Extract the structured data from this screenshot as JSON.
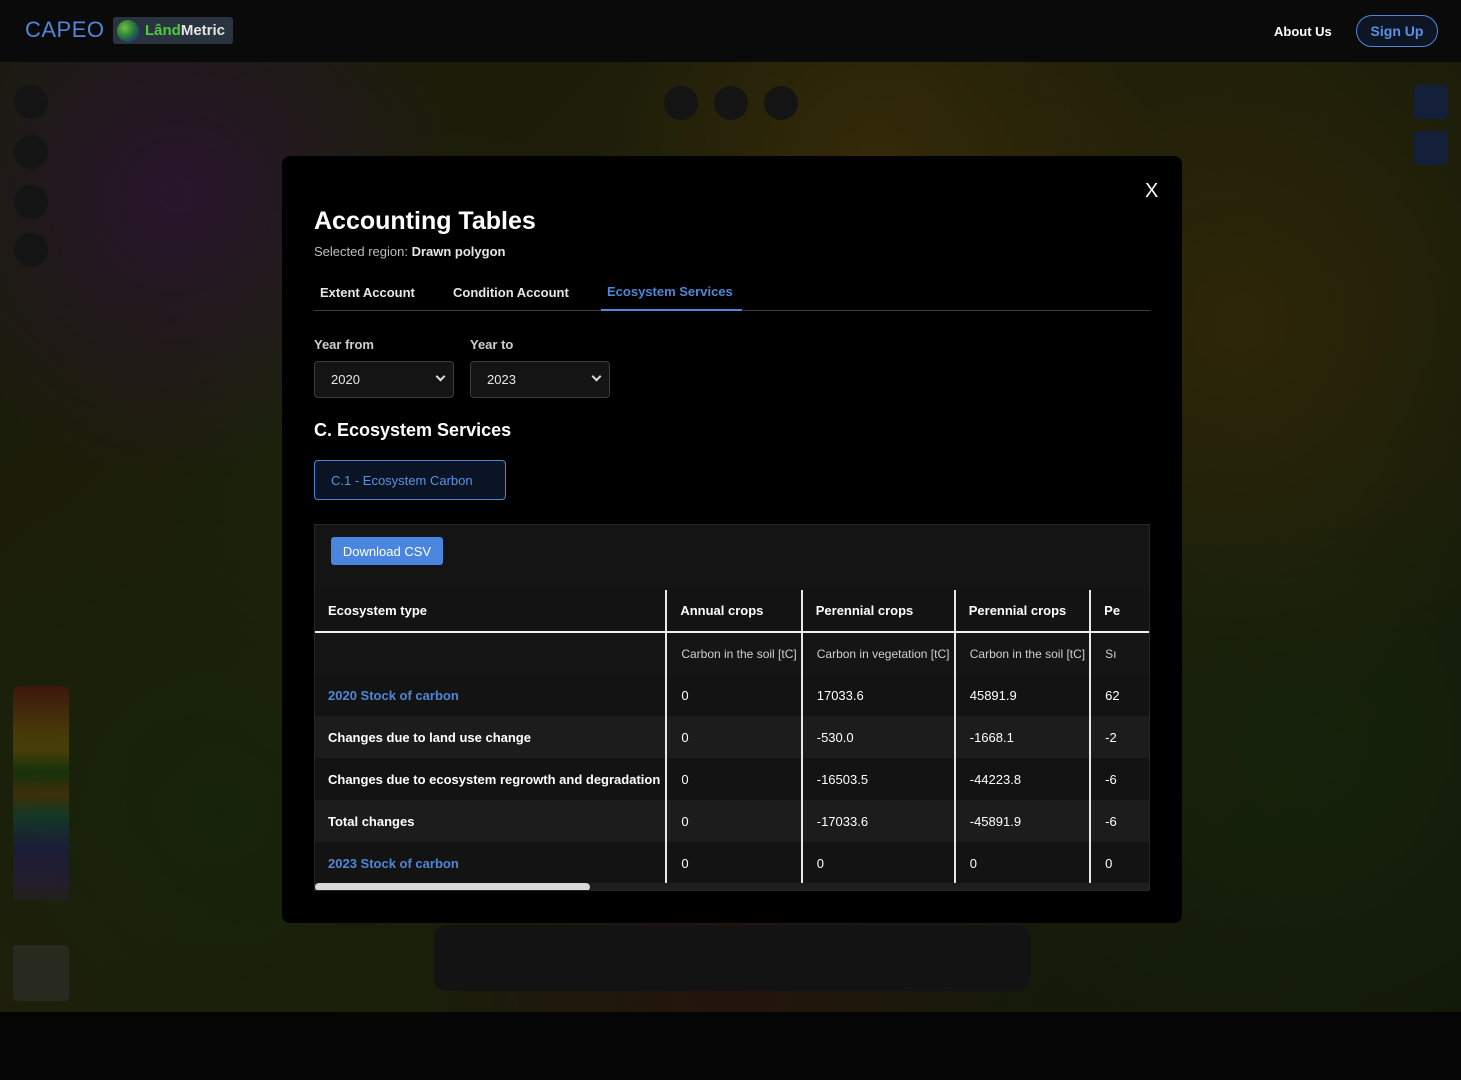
{
  "header": {
    "brand": "CAPEO",
    "logo_part1": "Lând",
    "logo_part2": "Metric",
    "about_label": "About Us",
    "signup_label": "Sign Up"
  },
  "modal": {
    "close_label": "X",
    "title": "Accounting Tables",
    "region_prefix": "Selected region:",
    "region_value": "Drawn polygon",
    "tabs": [
      {
        "label": "Extent Account",
        "active": false
      },
      {
        "label": "Condition Account",
        "active": false
      },
      {
        "label": "Ecosystem Services",
        "active": true
      }
    ],
    "year_from_label": "Year from",
    "year_from_value": "2020",
    "year_to_label": "Year to",
    "year_to_value": "2023",
    "section_title": "C. Ecosystem Services",
    "subsection_button": "C.1 - Ecosystem Carbon",
    "download_label": "Download CSV"
  },
  "table": {
    "header": [
      "Ecosystem type",
      "Annual crops",
      "Perennial crops",
      "Perennial crops",
      "Pe"
    ],
    "subheader": [
      "",
      "Carbon in the soil [tC]",
      "Carbon in vegetation [tC]",
      "Carbon in the soil [tC]",
      "Sı"
    ],
    "rows": [
      {
        "label": "2020 Stock of carbon",
        "link": true,
        "values": [
          "0",
          "17033.6",
          "45891.9",
          "62"
        ]
      },
      {
        "label": "Changes due to land use change",
        "link": false,
        "values": [
          "0",
          "-530.0",
          "-1668.1",
          "-2"
        ]
      },
      {
        "label": "Changes due to ecosystem regrowth and degradation",
        "link": false,
        "values": [
          "0",
          "-16503.5",
          "-44223.8",
          "-6"
        ]
      },
      {
        "label": "Total changes",
        "link": false,
        "values": [
          "0",
          "-17033.6",
          "-45891.9",
          "-6"
        ]
      },
      {
        "label": "2023 Stock of carbon",
        "link": true,
        "values": [
          "0",
          "0",
          "0",
          "0"
        ]
      }
    ]
  },
  "colors": {
    "accent": "#4f86d8",
    "modal_bg": "#000000",
    "download_button": "#4a86df"
  }
}
